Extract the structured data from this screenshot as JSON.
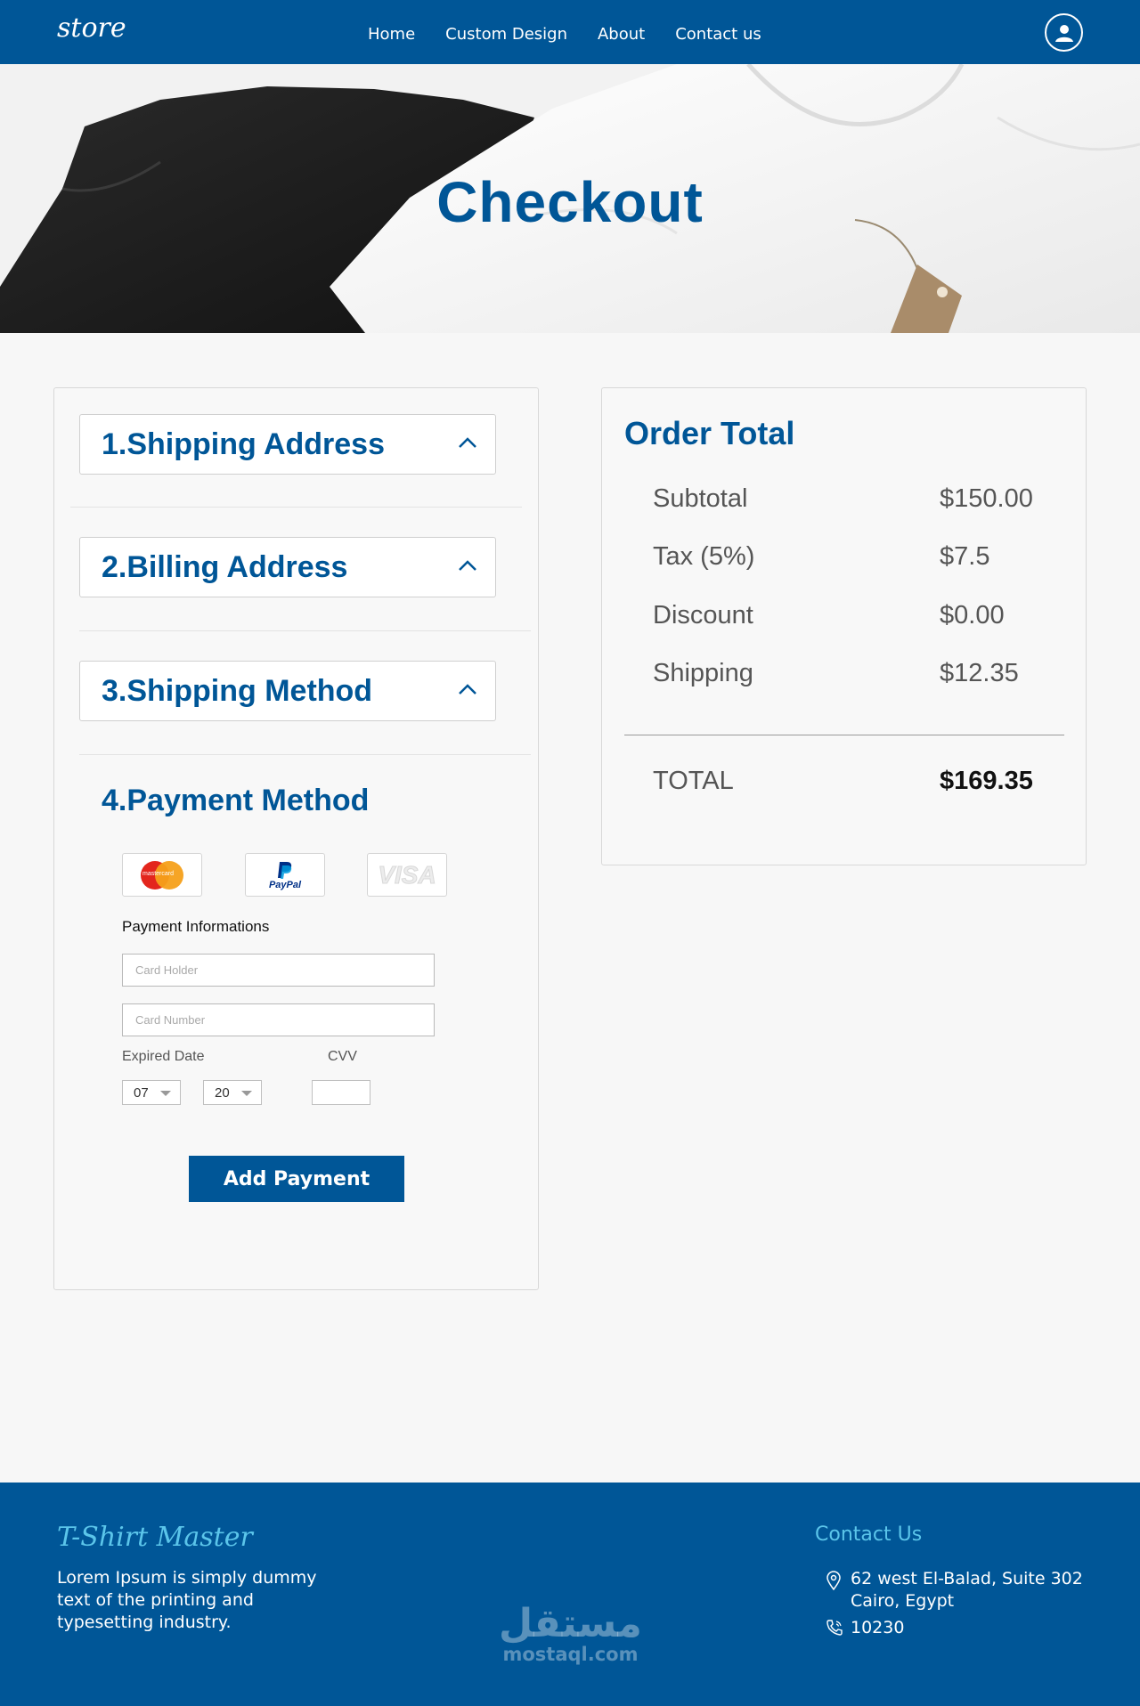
{
  "header": {
    "logo": "store",
    "nav": [
      "Home",
      "Custom Design",
      "About",
      "Contact us"
    ]
  },
  "hero": {
    "title": "Checkout"
  },
  "checkout": {
    "sections": [
      "1.Shipping Address",
      "2.Billing Address",
      "3.Shipping Method"
    ],
    "payment_title": "4.Payment Method",
    "cards": {
      "mastercard": "mastercard",
      "paypal": "PayPal",
      "visa": "VISA"
    },
    "payment_info_label": "Payment Informations",
    "card_holder_placeholder": "Card Holder",
    "card_number_placeholder": "Card Number",
    "expired_label": "Expired Date",
    "cvv_label": "CVV",
    "month": "07",
    "year": "20",
    "add_button": "Add Payment"
  },
  "order": {
    "title": "Order Total",
    "rows": [
      {
        "label": "Subtotal",
        "value": "$150.00"
      },
      {
        "label": "Tax (5%)",
        "value": "$7.5"
      },
      {
        "label": "Discount",
        "value": "$0.00"
      },
      {
        "label": "Shipping",
        "value": "$12.35"
      }
    ],
    "total_label": "TOTAL",
    "total_value": "$169.35"
  },
  "footer": {
    "brand": "T-Shirt Master",
    "description": "Lorem Ipsum is simply dummy text of the printing and typesetting industry.",
    "contact_title": "Contact Us",
    "address_line1": "62 west El-Balad, Suite 302",
    "address_line2": "Cairo, Egypt",
    "phone": "10230",
    "watermark_ar": "مستقل",
    "watermark_latin": "mostaql.com"
  },
  "colors": {
    "primary": "#005697",
    "accent": "#5bc5ea",
    "background": "#f7f7f7"
  }
}
